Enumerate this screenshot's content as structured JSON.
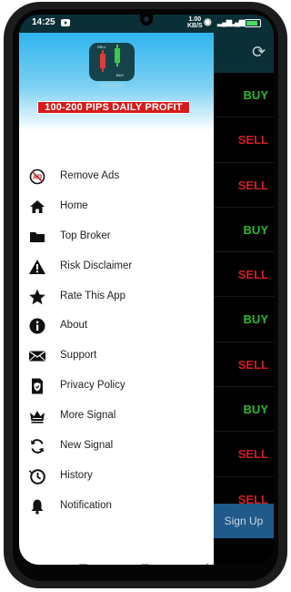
{
  "status_bar": {
    "time": "14:25",
    "speed_value": "1.00",
    "speed_unit": "KB/S"
  },
  "drawer": {
    "banner_text": "100-200 PIPS DAILY PROFIT",
    "logo_labels": {
      "sell": "SELL",
      "buy": "BUY"
    },
    "menu": [
      {
        "label": "Remove Ads",
        "icon": "remove-ads-icon"
      },
      {
        "label": "Home",
        "icon": "home-icon"
      },
      {
        "label": "Top Broker",
        "icon": "folder-icon"
      },
      {
        "label": "Risk Disclaimer",
        "icon": "warning-icon"
      },
      {
        "label": "Rate This App",
        "icon": "star-icon"
      },
      {
        "label": "About",
        "icon": "info-icon"
      },
      {
        "label": "Support",
        "icon": "mail-icon"
      },
      {
        "label": "Privacy Policy",
        "icon": "shield-icon"
      },
      {
        "label": "More Signal",
        "icon": "crown-icon"
      },
      {
        "label": "New Signal",
        "icon": "refresh-icon"
      },
      {
        "label": "History",
        "icon": "history-icon"
      },
      {
        "label": "Notification",
        "icon": "bell-icon"
      }
    ]
  },
  "signals": [
    "BUY",
    "SELL",
    "SELL",
    "BUY",
    "SELL",
    "BUY",
    "SELL",
    "BUY",
    "SELL",
    "SELL"
  ],
  "signup_label": "Sign Up",
  "colors": {
    "buy": "#2eb82e",
    "sell": "#d02020",
    "header": "#0b2f36",
    "banner": "#d71a1a",
    "signup": "#1f5a8a"
  }
}
